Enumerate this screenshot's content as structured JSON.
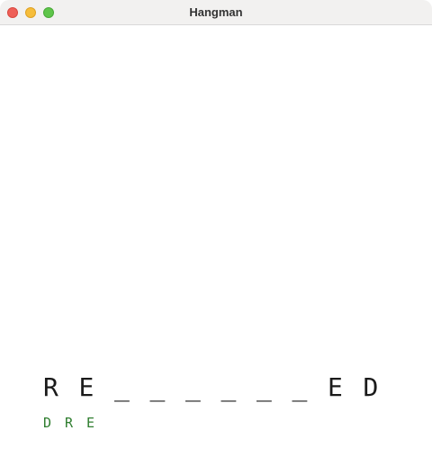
{
  "window": {
    "title": "Hangman"
  },
  "game": {
    "word_slots": [
      "R",
      "E",
      "_",
      "_",
      "_",
      "_",
      "_",
      "_",
      "E",
      "D"
    ],
    "guessed_letters": [
      "D",
      "R",
      "E"
    ]
  },
  "colors": {
    "guessed_letters": "#2e7d2e",
    "word_text": "#1a1a1a"
  }
}
